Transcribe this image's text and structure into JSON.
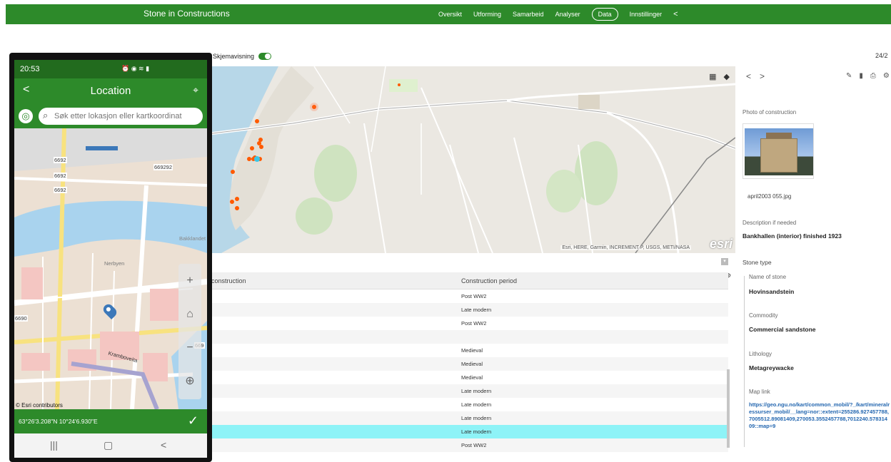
{
  "app": {
    "title": "Stone in Constructions",
    "nav": [
      "Oversikt",
      "Utforming",
      "Samarbeid",
      "Analyser",
      "Data",
      "Innstillinger"
    ],
    "active_nav": "Data"
  },
  "toolbar": {
    "toggle_label": "Skjemavisning",
    "page_count": "24/2"
  },
  "map": {
    "attribution": "Esri, HERE, Garmin, INCREMENT P, USGS, METI/NASA",
    "logo": "esri"
  },
  "table": {
    "col_construction": "construction",
    "col_period": "Construction period",
    "rows": [
      "Post WW2",
      "Late modern",
      "Post WW2",
      "",
      "Medieval",
      "Medieval",
      "Medieval",
      "Late modern",
      "Late modern",
      "Late modern",
      "Late modern",
      "Post WW2"
    ],
    "selected_index": 10
  },
  "panel": {
    "photo_label": "Photo of construction",
    "photo_caption": "april2003 055.jpg",
    "desc_label": "Description if needed",
    "desc_value": "Bankhallen (interior) finished 1923",
    "stone_type_label": "Stone type",
    "name_label": "Name of stone",
    "name_value": "Hovinsandstein",
    "commodity_label": "Commodity",
    "commodity_value": "Commercial sandstone",
    "lithology_label": "Lithology",
    "lithology_value": "Metagreywacke",
    "maplink_label": "Map link",
    "maplink_value": "https://geo.ngu.no/kart/common_mobil/?_/kart/mineralressurser_mobil/__lang=nor::extent=255286.927457788,7005512.89081409,270053.3552457788,7012240.57831409::map=9"
  },
  "phone": {
    "time": "20:53",
    "title": "Location",
    "search_placeholder": "Søk etter lokasjon eller kartkoordinat",
    "coords": "63°26'3.208\"N 10°24'6.930\"E",
    "attribution": "© Esri contributors",
    "map_labels": [
      "6692",
      "669292",
      "6692",
      "6692",
      "Nerbyen",
      "Kramboveita",
      "6690",
      "Bakklandet",
      "669"
    ]
  }
}
